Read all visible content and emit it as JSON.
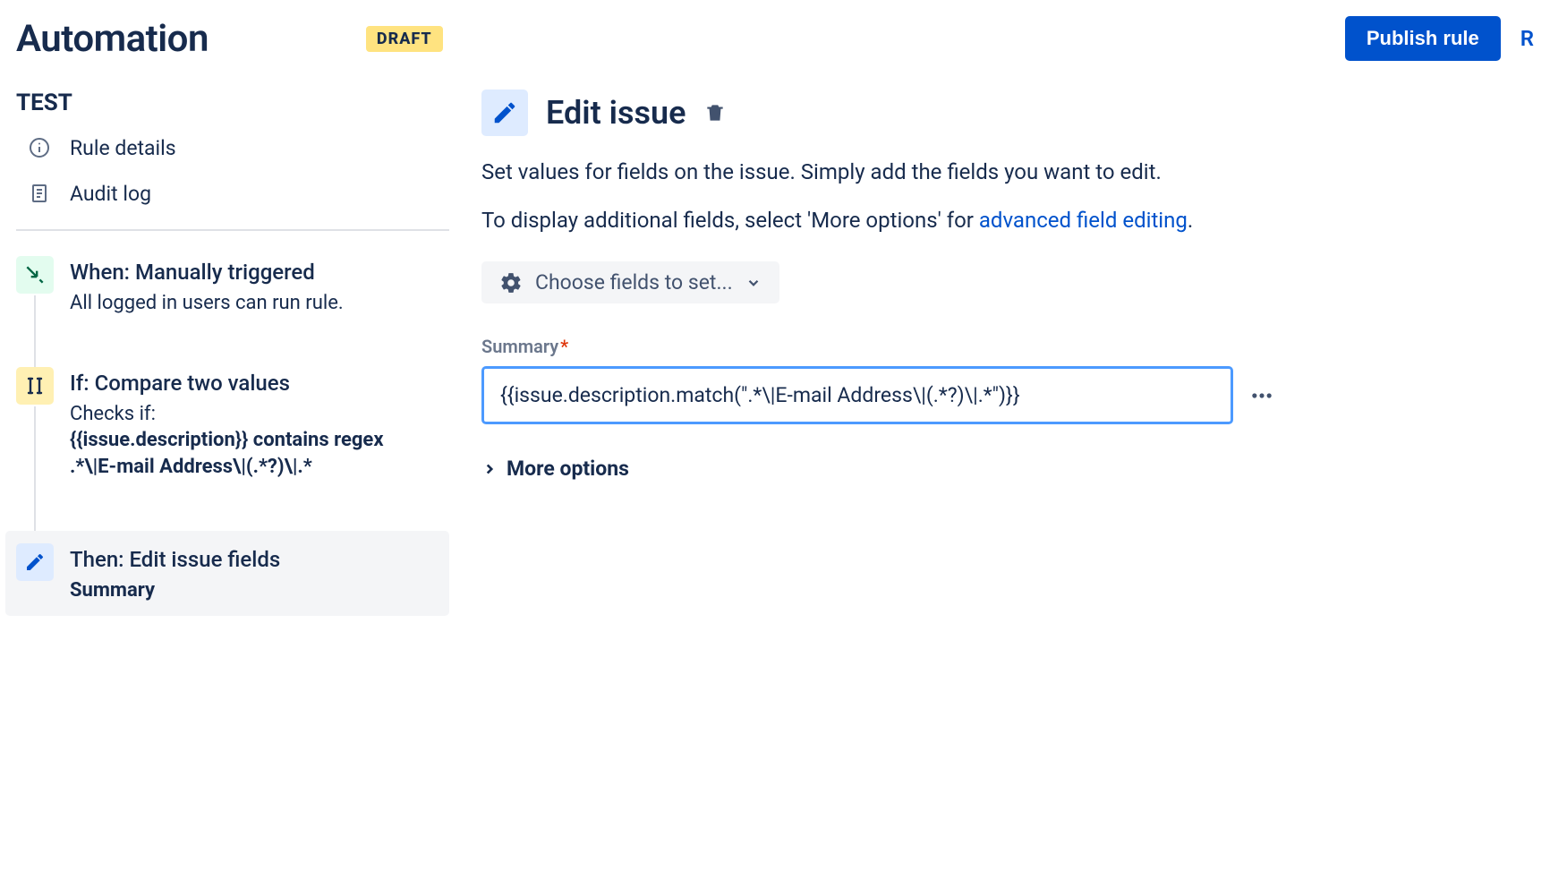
{
  "header": {
    "title": "Automation",
    "badge": "DRAFT",
    "publish_label": "Publish rule",
    "trailing": "R"
  },
  "sidebar": {
    "rule_name": "TEST",
    "nav": {
      "rule_details": "Rule details",
      "audit_log": "Audit log"
    },
    "steps": {
      "trigger": {
        "title": "When: Manually triggered",
        "desc": "All logged in users can run rule."
      },
      "condition": {
        "title": "If: Compare two values",
        "desc_lead": "Checks if:",
        "desc_bold1": "{{issue.description}} contains regex",
        "desc_bold2": ".*\\|E-mail Address\\|(.*?)\\|.*"
      },
      "action": {
        "title": "Then: Edit issue fields",
        "subtitle": "Summary"
      }
    }
  },
  "content": {
    "title": "Edit issue",
    "desc1": "Set values for fields on the issue. Simply add the fields you want to edit.",
    "desc2_pre": "To display additional fields, select 'More options' for ",
    "desc2_link": "advanced field editing",
    "desc2_post": ".",
    "choose_fields": "Choose fields to set...",
    "summary_label": "Summary",
    "summary_value": "{{issue.description.match(\".*\\|E-mail Address\\|(.*?)\\|.*\")}}",
    "more_options": "More options"
  }
}
